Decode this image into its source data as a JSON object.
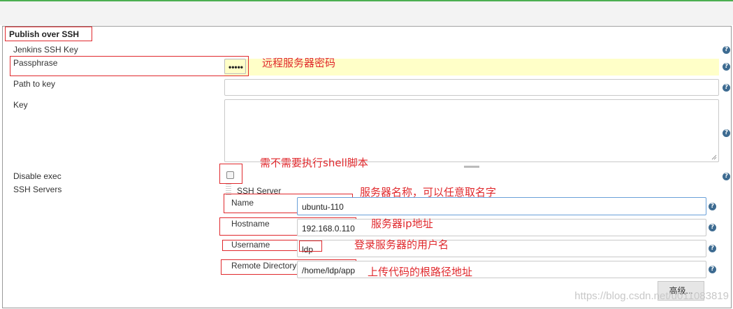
{
  "section": {
    "title": "Publish over SSH"
  },
  "fields": {
    "jenkins_ssh_key": "Jenkins SSH Key",
    "passphrase": {
      "label": "Passphrase",
      "value": "•••••"
    },
    "path_to_key": {
      "label": "Path to key",
      "value": ""
    },
    "key": {
      "label": "Key",
      "value": ""
    },
    "disable_exec": {
      "label": "Disable exec",
      "checked": false
    },
    "ssh_servers": "SSH Servers"
  },
  "server": {
    "header": "SSH Server",
    "name": {
      "label": "Name",
      "value": "ubuntu-110"
    },
    "hostname": {
      "label": "Hostname",
      "value": "192.168.0.110"
    },
    "username": {
      "label": "Username",
      "value": "ldp"
    },
    "remote_directory": {
      "label": "Remote Directory",
      "value": "/home/ldp/app"
    },
    "advanced_button": "高级..."
  },
  "annotations": {
    "passphrase": "远程服务器密码",
    "disable_exec": "需不需要执行shell脚本",
    "name": "服务器名称，可以任意取名字",
    "hostname": "服务器ip地址",
    "username": "登录服务器的用户名",
    "remote_directory": "上传代码的根路径地址"
  },
  "watermark": "https://blog.csdn.net/u011083819",
  "icons": {
    "help": "help-icon",
    "checkbox": "checkbox-icon"
  },
  "colors": {
    "annotation": "#e0292d",
    "help": "#3d6b91",
    "highlight": "#ffffc8",
    "top_bar": "#4caf50"
  }
}
